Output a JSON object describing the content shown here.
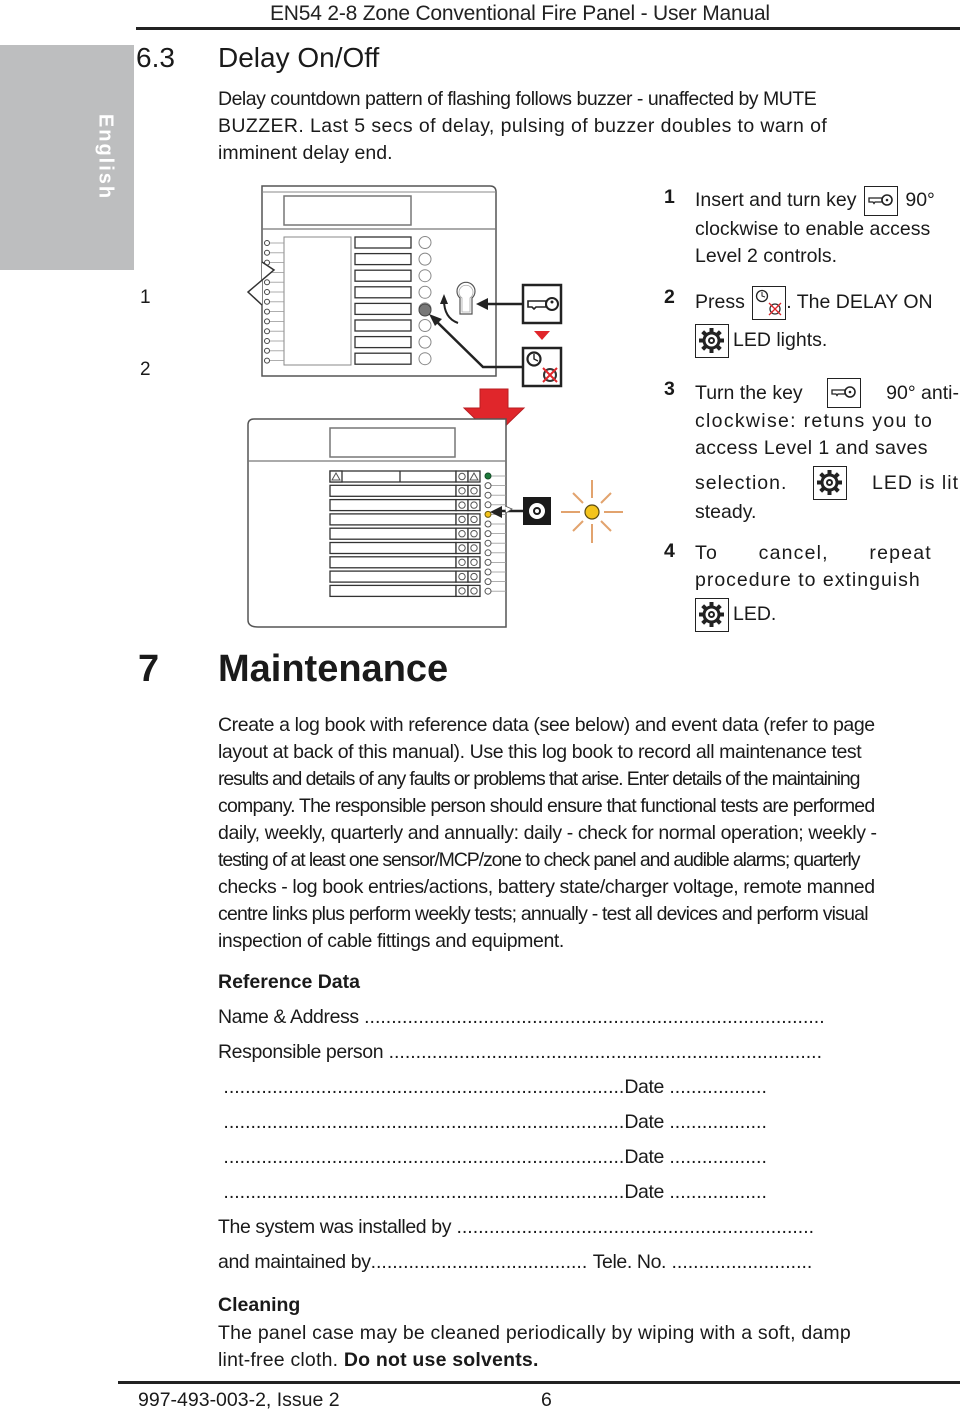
{
  "header": {
    "title": "EN54 2-8 Zone Conventional Fire Panel - User Manual"
  },
  "language_tab": "English",
  "section_6_3": {
    "number": "6.3",
    "title": "Delay On/Off",
    "intro_lines": [
      "Delay countdown pattern of flashing follows buzzer - unaffected by MUTE",
      "BUZZER. Last 5 secs of delay, pulsing of buzzer doubles to warn of",
      "imminent delay end."
    ],
    "diagram_callouts": [
      "1",
      "2"
    ],
    "steps": [
      {
        "n": "1",
        "parts": [
          "Insert and turn key",
          "90°",
          "clockwise to enable access",
          "Level 2 controls."
        ]
      },
      {
        "n": "2",
        "parts": [
          "Press",
          ". The DELAY ON",
          "LED lights."
        ]
      },
      {
        "n": "3",
        "parts": [
          "Turn the key",
          "90° anti-",
          "clockwise: retuns you to",
          "access Level 1 and saves",
          "selection.",
          "LED is lit",
          "steady."
        ]
      },
      {
        "n": "4",
        "parts": [
          "To cancel, repeat",
          "procedure to extinguish",
          "LED."
        ]
      }
    ],
    "icons": [
      "key-icon",
      "delay-timer-icon",
      "delay-on-led-icon"
    ]
  },
  "section_7": {
    "number": "7",
    "title": "Maintenance",
    "body_lines": [
      "Create a log book with reference data (see below) and event data (refer to page",
      "layout at back of this manual). Use this log book to record all maintenance test",
      "results and details of any faults or problems that arise. Enter details of the maintaining",
      "company. The responsible person should ensure that functional tests are performed",
      "daily, weekly, quarterly and annually: daily - check for normal operation; weekly -",
      "testing of at least one sensor/MCP/zone to check panel and audible alarms; quarterly",
      "checks - log book entries/actions, battery state/charger voltage, remote manned",
      "centre links plus perform weekly tests; annually - test all devices and perform visual",
      "inspection of cable fittings and equipment."
    ]
  },
  "reference_data": {
    "title": "Reference Data",
    "name_address": "Name & Address",
    "responsible_person": "Responsible person",
    "date_label": "Date",
    "date_rows": 4,
    "installed_by": "The system was installed by",
    "maintained_by": "and maintained by",
    "tele_no": "Tele. No."
  },
  "cleaning": {
    "title": "Cleaning",
    "line1": "The panel case may be cleaned periodically by wiping with a soft, damp",
    "line2": "lint-free cloth.",
    "warning": "Do not use solvents."
  },
  "footer": {
    "doc_ref": "997-493-003-2, Issue 2",
    "page": "6"
  },
  "colors": {
    "arrow_red": "#e0262b",
    "led_green": "#1f7a3c",
    "led_yellow": "#f4c41c",
    "rays": "#e2a36e",
    "tab_gray": "#bdbebf"
  }
}
